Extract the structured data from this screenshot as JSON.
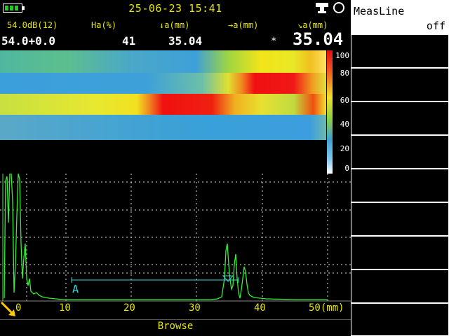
{
  "status_bar": {
    "battery_icon": "battery-icon",
    "datetime": "25-06-23 15:41",
    "probe_icon": "probe-icon",
    "status_icon": "circle-icon"
  },
  "measure_header": {
    "labels": [
      "54.0dB(12)",
      "Ha(%)",
      "↓a(mm)",
      "→a(mm)",
      "↘a(mm)"
    ],
    "gain_value": "54.0+0.0",
    "ha_value": "41",
    "depth_value": "35.04",
    "star": "*",
    "path_value": "35.04"
  },
  "color_scale": {
    "ticks": [
      "100",
      "80",
      "60",
      "40",
      "20",
      "0"
    ]
  },
  "ascan": {
    "x_ticks": [
      "0",
      "10",
      "20",
      "30",
      "40",
      "50(mm)"
    ],
    "gate_label": "A",
    "gate_color": "#33dddd",
    "trace_color": "#33ee33",
    "axis_label_color": "#e6e600"
  },
  "footer": {
    "mode": "Browse"
  },
  "menu": {
    "measline_label": "MeasLine",
    "measline_value": "off"
  }
}
